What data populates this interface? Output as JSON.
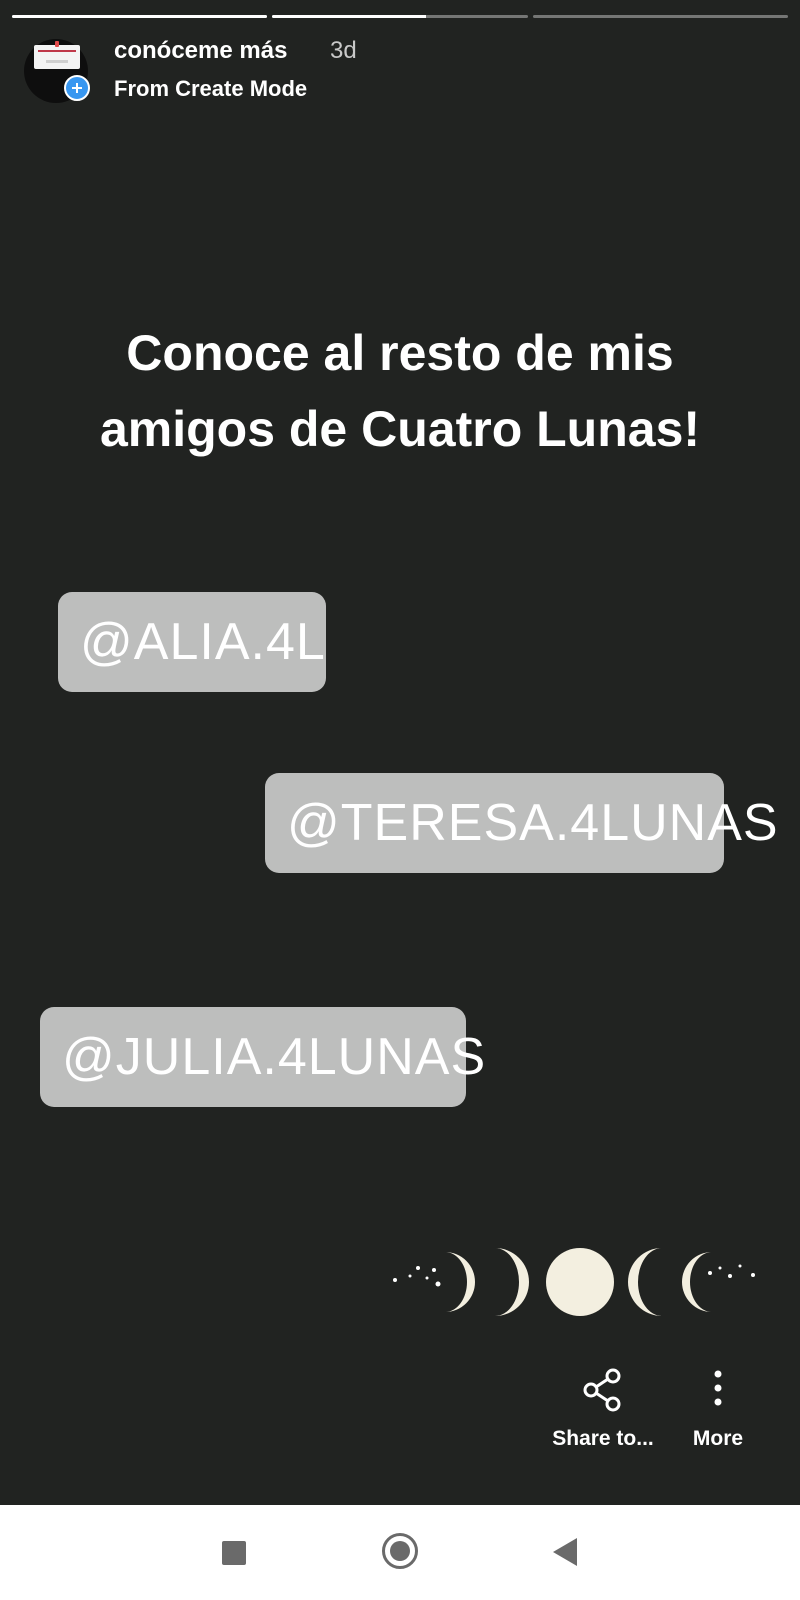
{
  "story": {
    "name": "conóceme más",
    "age": "3d",
    "subtitle": "From Create Mode",
    "progress_segments": [
      1,
      0.6,
      0
    ]
  },
  "content": {
    "headline_line1": "Conoce al resto de mis",
    "headline_line2": "amigos de Cuatro Lunas!",
    "mentions": [
      "@ALIA.4L",
      "@TERESA.4LUNAS",
      "@JULIA.4LUNAS"
    ],
    "decoration": "moon-phases-sticker"
  },
  "actions": {
    "share_label": "Share to...",
    "more_label": "More"
  },
  "icons": {
    "share": "share-icon",
    "more": "more-vertical-icon",
    "add": "plus-icon"
  },
  "colors": {
    "background": "#212321",
    "mention_bg": "#bdbebd",
    "badge": "#3897f0"
  }
}
